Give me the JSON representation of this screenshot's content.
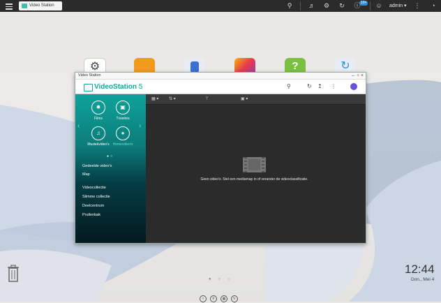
{
  "topbar": {
    "tab_label": "Video Station",
    "notification_badge": "10+",
    "user": "admin ▾",
    "icons": [
      "menu-icon",
      "search-icon",
      "volume-icon",
      "sync-icon",
      "info-icon",
      "user-icon",
      "more-icon",
      "dashboard-icon"
    ]
  },
  "window": {
    "title": "Video Station",
    "controls": [
      "–",
      "+",
      "×"
    ],
    "brand": "VideoStation",
    "brand_version": "5",
    "categories": [
      {
        "label": "Films",
        "icon": "film-reel-icon"
      },
      {
        "label": "Tvseries",
        "icon": "tv-icon"
      },
      {
        "label": "Muziekvideo's",
        "icon": "music-video-icon"
      },
      {
        "label": "Homevideo's",
        "icon": "camera-icon"
      }
    ],
    "nav_items": [
      "Gedeelde video's",
      "Map",
      "Videocollectie",
      "Slimme collectie",
      "Deelcentrum",
      "Prullenbak"
    ],
    "empty_message": "Geen video's. Stel een mediamap in of verander de videoclassificatie."
  },
  "clock": {
    "time": "12:44",
    "date": "Don., Mei 4"
  },
  "colors": {
    "accent": "#13a89e",
    "topbar": "#2b2b2b",
    "panel": "#2b2b2b"
  }
}
